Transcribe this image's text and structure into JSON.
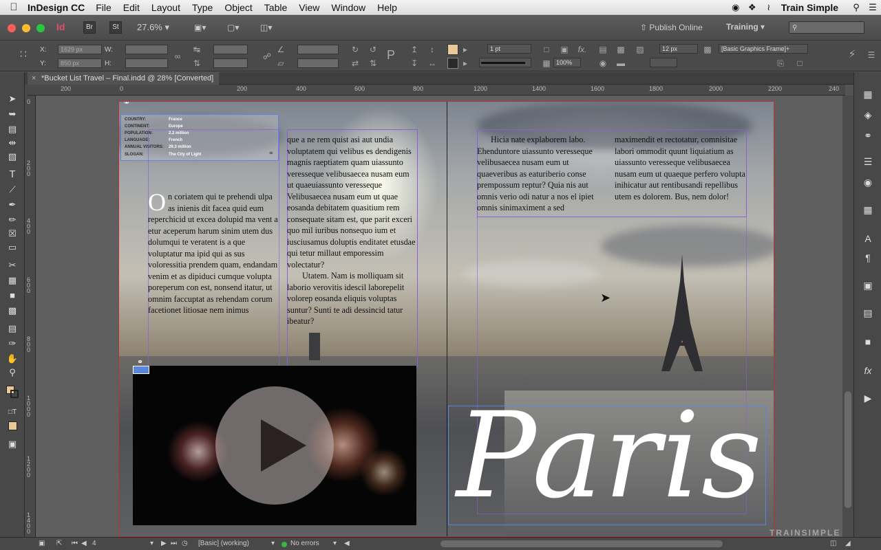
{
  "menubar": {
    "app_name": "InDesign CC",
    "items": [
      "File",
      "Edit",
      "Layout",
      "Type",
      "Object",
      "Table",
      "View",
      "Window",
      "Help"
    ],
    "user": "Train Simple"
  },
  "appbar": {
    "bridge": "Br",
    "stock": "St",
    "zoom": "27.6%",
    "publish": "Publish Online",
    "workspace": "Training"
  },
  "control": {
    "x_label": "X:",
    "y_label": "Y:",
    "w_label": "W:",
    "h_label": "H:",
    "x_value": "1629 px",
    "y_value": "850 px",
    "stroke_weight": "1 pt",
    "opacity": "100%",
    "offset": "12 px",
    "object_style": "[Basic Graphics Frame]+"
  },
  "document": {
    "tab_title": "*Bucket List Travel – Final.indd @ 28% [Converted]"
  },
  "ruler": {
    "h_ticks": [
      "200",
      "0",
      "200",
      "400",
      "600",
      "800",
      "1000",
      "1200",
      "1400",
      "1600",
      "1800",
      "2000",
      "2200",
      "240"
    ],
    "v_ticks": [
      "0",
      "2 0 0",
      "4 0 0",
      "6 0 0",
      "8 0 0",
      "1 0 0 0",
      "1 2 0 0",
      "1 4 0 0"
    ]
  },
  "info_box": {
    "labels": [
      "COUNTRY:",
      "CONTINENT:",
      "POPULATION:",
      "LANGUAGE:",
      "ANNUAL VISITORS:",
      "SLOGAN:"
    ],
    "values": [
      "France",
      "Europe",
      "2.2 million",
      "French",
      "29.3 million",
      "The City of Light"
    ]
  },
  "column1": {
    "dropcap": "O",
    "text": "n coriatem qui te prehendi ulpa as inienis dit facea quid eum reperchicid ut excea dolupid ma vent a etur aceperum harum sinim utem dus dolumqui te veratent is a que voluptatur ma ipid qui as sus voloressitia prendem quam, endandam venim et as dipiduci cumque volupta poreperum con est, nonsend itatur, ut omnim faccuptat as rehendam corum facetionet litiosae nem inimus"
  },
  "column2": {
    "para1": "que a ne rem quist asi aut undia voluptatem qui velibus es dendigenis magnis raeptiatem quam uiassunto veresseque velibusaecea nusam eum ut quaeuiassunto veresseque Velibusaecea nusam eum ut quae eosanda debitatem quasitium rem consequate sitam est, que parit exceri quo mil iuribus nonsequo ium et iusciusamus doluptis enditatet etusdae qui tetur millaut emporessim volectatur?",
    "para2": "Utatem. Nam is molliquam sit laborio verovitis idescil laborepelit volorep eosanda eliquis voluptas suntur? Sunti te adi dessincid tatur ibeatur?"
  },
  "column3": {
    "text": "Hicia nate explaborem labo. Ehenduntore uiassunto veresseque velibusaecea nusam eum ut quaeveribus as eaturiberio conse prempossum reptur? Quia nis aut omnis verio odi natur a nos el ipiet omnis sinimaximent a sed"
  },
  "column4": {
    "text": "maximendit et rectotatur, comnisitae labori ommodit quunt liquiatium as uiassunto veresseque velibusaecea nusam eum ut quaeque perfero volupta inihicatur aut rentibusandi repellibus utem es dolorem. Bus, nem dolor!"
  },
  "headline": "Paris",
  "status": {
    "page": "4",
    "preflight_profile": "[Basic] (working)",
    "errors": "No errors",
    "watermark": "TRAINSIMPLE"
  },
  "colors": {
    "accent_frame": "#8a5fd8",
    "bleed": "#c03030",
    "ok_green": "#3cb34a"
  }
}
